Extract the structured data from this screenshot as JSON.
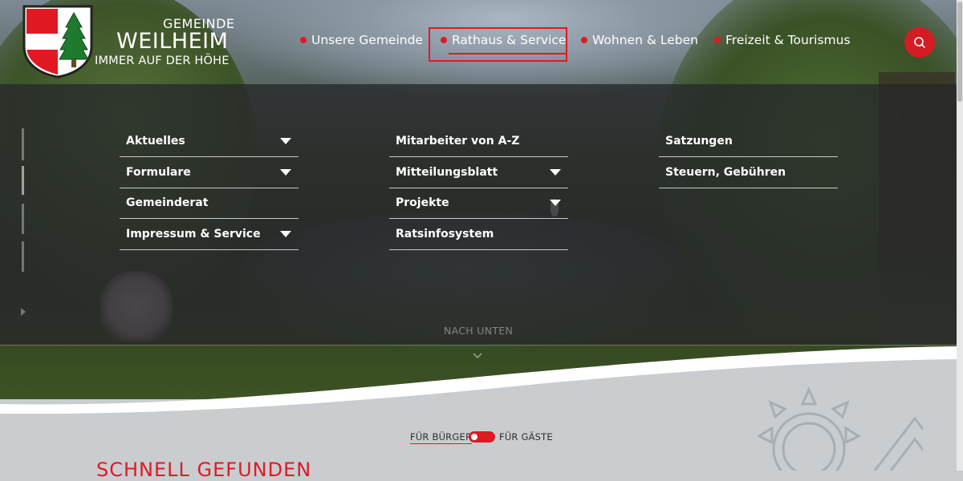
{
  "brand": {
    "pre": "GEMEINDE",
    "main": "WEILHEIM",
    "sub": "IMMER AUF DER HÖHE"
  },
  "nav": [
    {
      "label": "Unsere Gemeinde"
    },
    {
      "label": "Rathaus & Service",
      "active": true
    },
    {
      "label": "Wohnen & Leben"
    },
    {
      "label": "Freizeit & Tourismus"
    }
  ],
  "icons": {
    "search": "search-icon",
    "logo": "coat-of-arms-icon",
    "scroll": "chevron-down-icon",
    "expand": "caret-down-icon"
  },
  "mega_menu": {
    "col1": [
      {
        "label": "Aktuelles",
        "expandable": true
      },
      {
        "label": "Formulare",
        "expandable": true
      },
      {
        "label": "Gemeinderat",
        "expandable": false
      },
      {
        "label": "Impressum & Service",
        "expandable": true
      }
    ],
    "col2": [
      {
        "label": "Mitarbeiter von A-Z",
        "expandable": false
      },
      {
        "label": "Mitteilungsblatt",
        "expandable": true
      },
      {
        "label": "Projekte",
        "expandable": true
      },
      {
        "label": "Ratsinfosystem",
        "expandable": false
      }
    ],
    "col3": [
      {
        "label": "Satzungen",
        "expandable": false
      },
      {
        "label": "Steuern, Gebühren",
        "expandable": false
      }
    ]
  },
  "scroll_hint": "NACH UNTEN",
  "audience_toggle": {
    "left": "FÜR BÜRGER",
    "right": "FÜR GÄSTE"
  },
  "section_title": "SCHNELL GEFUNDEN",
  "colors": {
    "accent": "#e11922",
    "overlay": "#26282a",
    "bottom_bg": "#c9cdd0"
  }
}
